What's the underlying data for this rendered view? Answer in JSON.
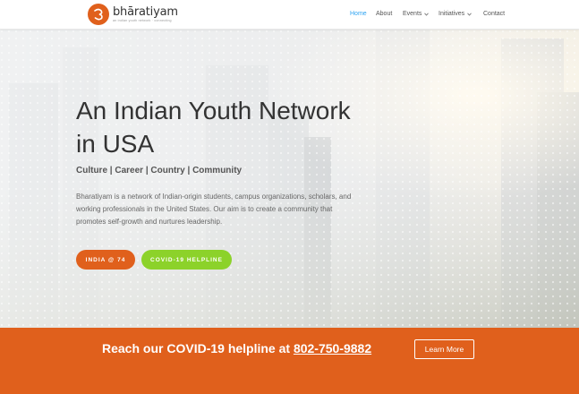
{
  "header": {
    "logo_name": "bhāratiyam",
    "logo_tagline": "an indian youth network · connecting",
    "nav": [
      {
        "label": "Home",
        "active": true,
        "has_dropdown": false
      },
      {
        "label": "About",
        "active": false,
        "has_dropdown": false
      },
      {
        "label": "Events",
        "active": false,
        "has_dropdown": true
      },
      {
        "label": "Initiatives",
        "active": false,
        "has_dropdown": true
      },
      {
        "label": "Contact",
        "active": false,
        "has_dropdown": false
      }
    ]
  },
  "hero": {
    "title": "An Indian Youth Network in USA",
    "subtitle": "Culture | Career | Country | Community",
    "body": "Bharatiyam is a network of Indian-origin students, campus organizations, scholars, and working professionals in the United States. Our aim is to create a community that promotes self-growth and nurtures leadership.",
    "buttons": [
      {
        "label": "INDIA @ 74",
        "color": "#e0601c"
      },
      {
        "label": "COVID-19 HELPLINE",
        "color": "#8cd22a"
      }
    ]
  },
  "banner": {
    "text": "Reach our COVID-19 helpline at ",
    "phone": "802-750-9882",
    "button_label": "Learn More",
    "color": "#e0601c"
  },
  "colors": {
    "accent": "#e0601c",
    "nav_active": "#2ea3f2",
    "helpline_green": "#8cd22a"
  }
}
